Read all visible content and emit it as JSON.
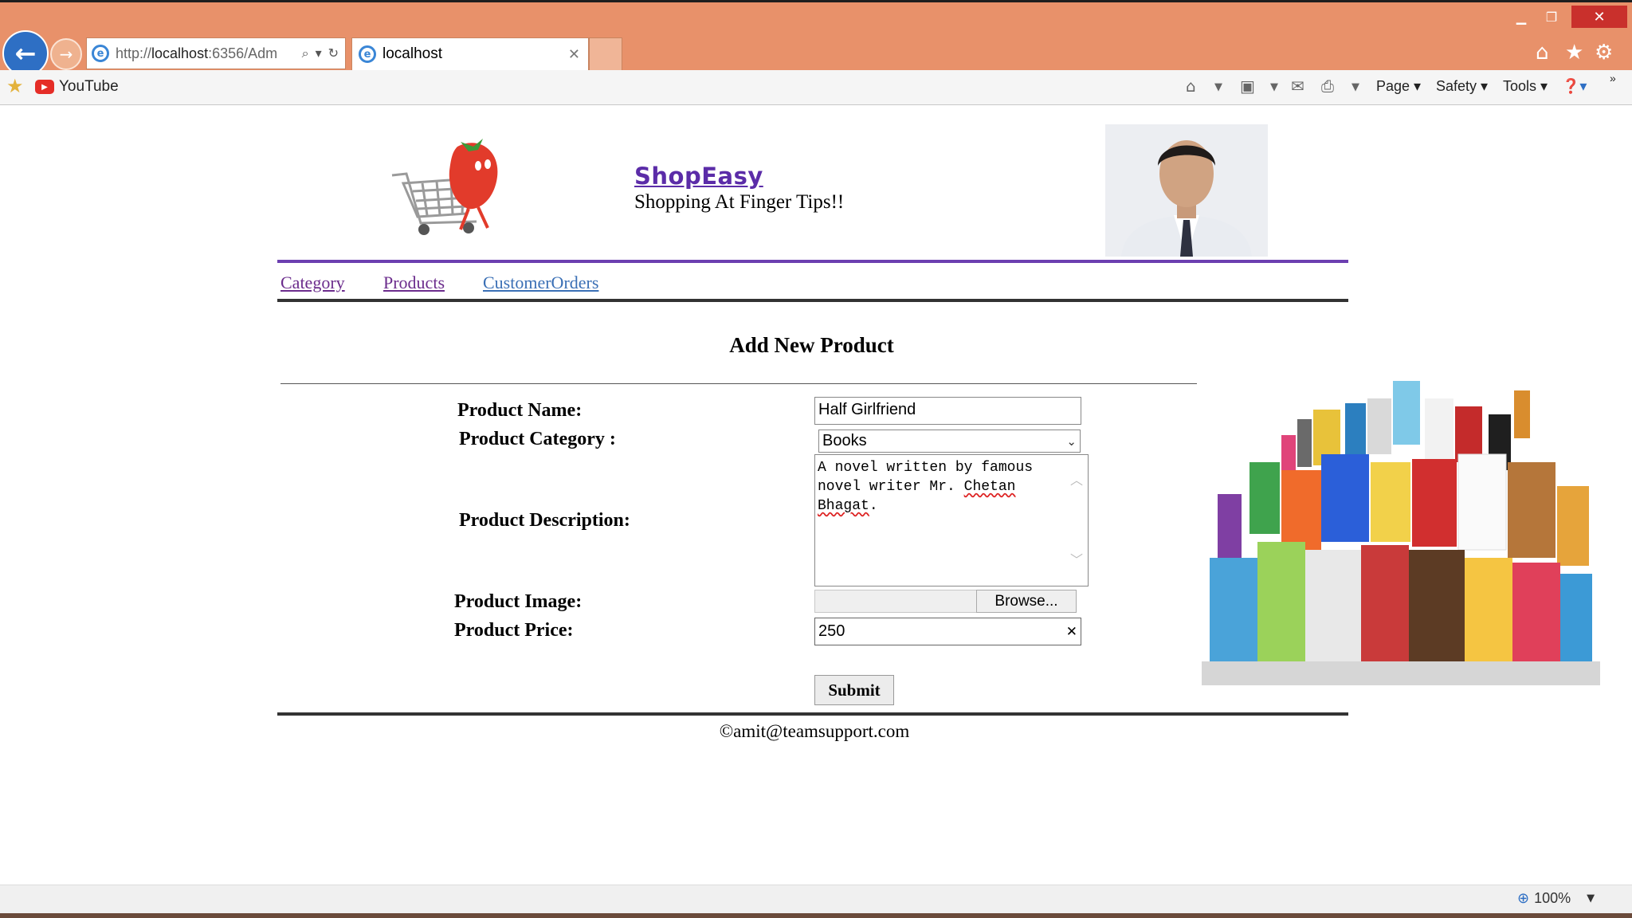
{
  "browser": {
    "address": {
      "scheme": "http://",
      "host": "localhost",
      "rest": ":6356/Adm"
    },
    "tab": {
      "title": "localhost"
    },
    "favorites": [
      {
        "label": "YouTube"
      }
    ],
    "commands": {
      "page": "Page",
      "safety": "Safety",
      "tools": "Tools"
    },
    "zoom": "100%",
    "icons": [
      "back-icon",
      "forward-icon",
      "ie-icon",
      "search-icon",
      "refresh-icon",
      "home-icon",
      "star-icon",
      "gear-icon",
      "rss-icon",
      "print-icon",
      "help-icon",
      "zoom-icon"
    ],
    "colors": {
      "frame": "#e8916a",
      "back_button": "#2e6fc4",
      "close_button": "#c9302c"
    }
  },
  "site": {
    "title": "ShopEasy",
    "tagline": "Shopping At Finger Tips!!",
    "nav": [
      {
        "label": "Category"
      },
      {
        "label": "Products"
      },
      {
        "label": "CustomerOrders"
      }
    ],
    "colors": {
      "title": "#5b2ca8",
      "rule": "#6c3fb0"
    }
  },
  "form": {
    "heading": "Add New Product",
    "labels": {
      "name": "Product Name:",
      "category": "Product Category :",
      "description": "Product Description:",
      "image": "Product Image:",
      "price": "Product Price:"
    },
    "values": {
      "name": "Half Girlfriend",
      "category": "Books",
      "description_line1": "A novel written by famous",
      "description_line2": "novel writer Mr. ",
      "description_spell1": "Chetan",
      "description_spell2": "Bhagat",
      "description_end": ".",
      "price": "250"
    },
    "browse_label": "Browse...",
    "submit_label": "Submit"
  },
  "footer": {
    "text": "©amit@teamsupport.com"
  }
}
